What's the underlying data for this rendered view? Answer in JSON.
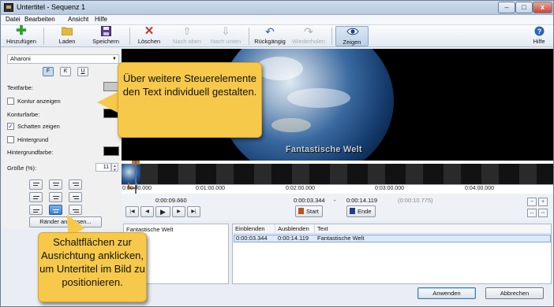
{
  "window": {
    "title": "Untertitel - Sequenz 1",
    "min_label": "–",
    "max_label": "□",
    "close_label": "x"
  },
  "menu": [
    "Datei",
    "Bearbeiten",
    "Ansicht",
    "Hilfe"
  ],
  "toolbar": {
    "add": "Hinzufügen",
    "load": "Laden",
    "save": "Speichern",
    "delete": "Löschen",
    "up": "Nach oben",
    "down": "Nach unten",
    "undo": "Rückgängig",
    "redo": "Wiederholen",
    "show": "Zeigen",
    "help": "Hilfe",
    "icons": [
      "plus-icon",
      "folder-icon",
      "floppy-icon",
      "x-icon",
      "arrow-up-icon",
      "arrow-down-icon",
      "undo-icon",
      "redo-icon",
      "eye-icon",
      "help-icon"
    ]
  },
  "format": {
    "font": "Aharoni",
    "bold": "F",
    "italic": "K",
    "underline": "U",
    "text_color_label": "Textfarbe:",
    "outline_checkbox": "Kontur anzeigen",
    "outline_color_label": "Konturfarbe:",
    "shadow_checkbox": "Schatten zeigen",
    "background_checkbox": "Hintergrund",
    "background_color_label": "Hintergrundfarbe:",
    "size_label": "Größe (%):",
    "size_value": "11",
    "margins_button": "Ränder anpassen...",
    "colors": {
      "text": "#c8c8c8",
      "outline": "#000000",
      "background": "#000000"
    }
  },
  "preview": {
    "subtitle": "Fantastische Welt"
  },
  "timeline": {
    "ticks": [
      "0:00:00.000",
      "0:01:00.000",
      "0:02:00.000",
      "0:03:00.000",
      "0:04:00.000"
    ]
  },
  "controls": {
    "current_time": "0:00:09.660",
    "start_time": "0:00:03.344",
    "separator": "-",
    "end_time": "0:00:14.119",
    "duration": "(0:00:10.775)",
    "start_button": "Start",
    "end_button": "Ende"
  },
  "text_input": "Fantastische Welt",
  "table": {
    "headers": [
      "Einblenden",
      "Ausblenden",
      "Text"
    ],
    "rows": [
      {
        "in": "0:00:03.344",
        "out": "0:00:14.119",
        "text": "Fantastische Welt"
      }
    ]
  },
  "footer": {
    "apply": "Anwenden",
    "cancel": "Abbrechen"
  },
  "callouts": {
    "top": "Über weitere Steuerelemente den Text individuell gestalten.",
    "bottom": "Schaltflächen zur Ausrichtung anklicken, um Untertitel im Bild zu positionieren."
  }
}
